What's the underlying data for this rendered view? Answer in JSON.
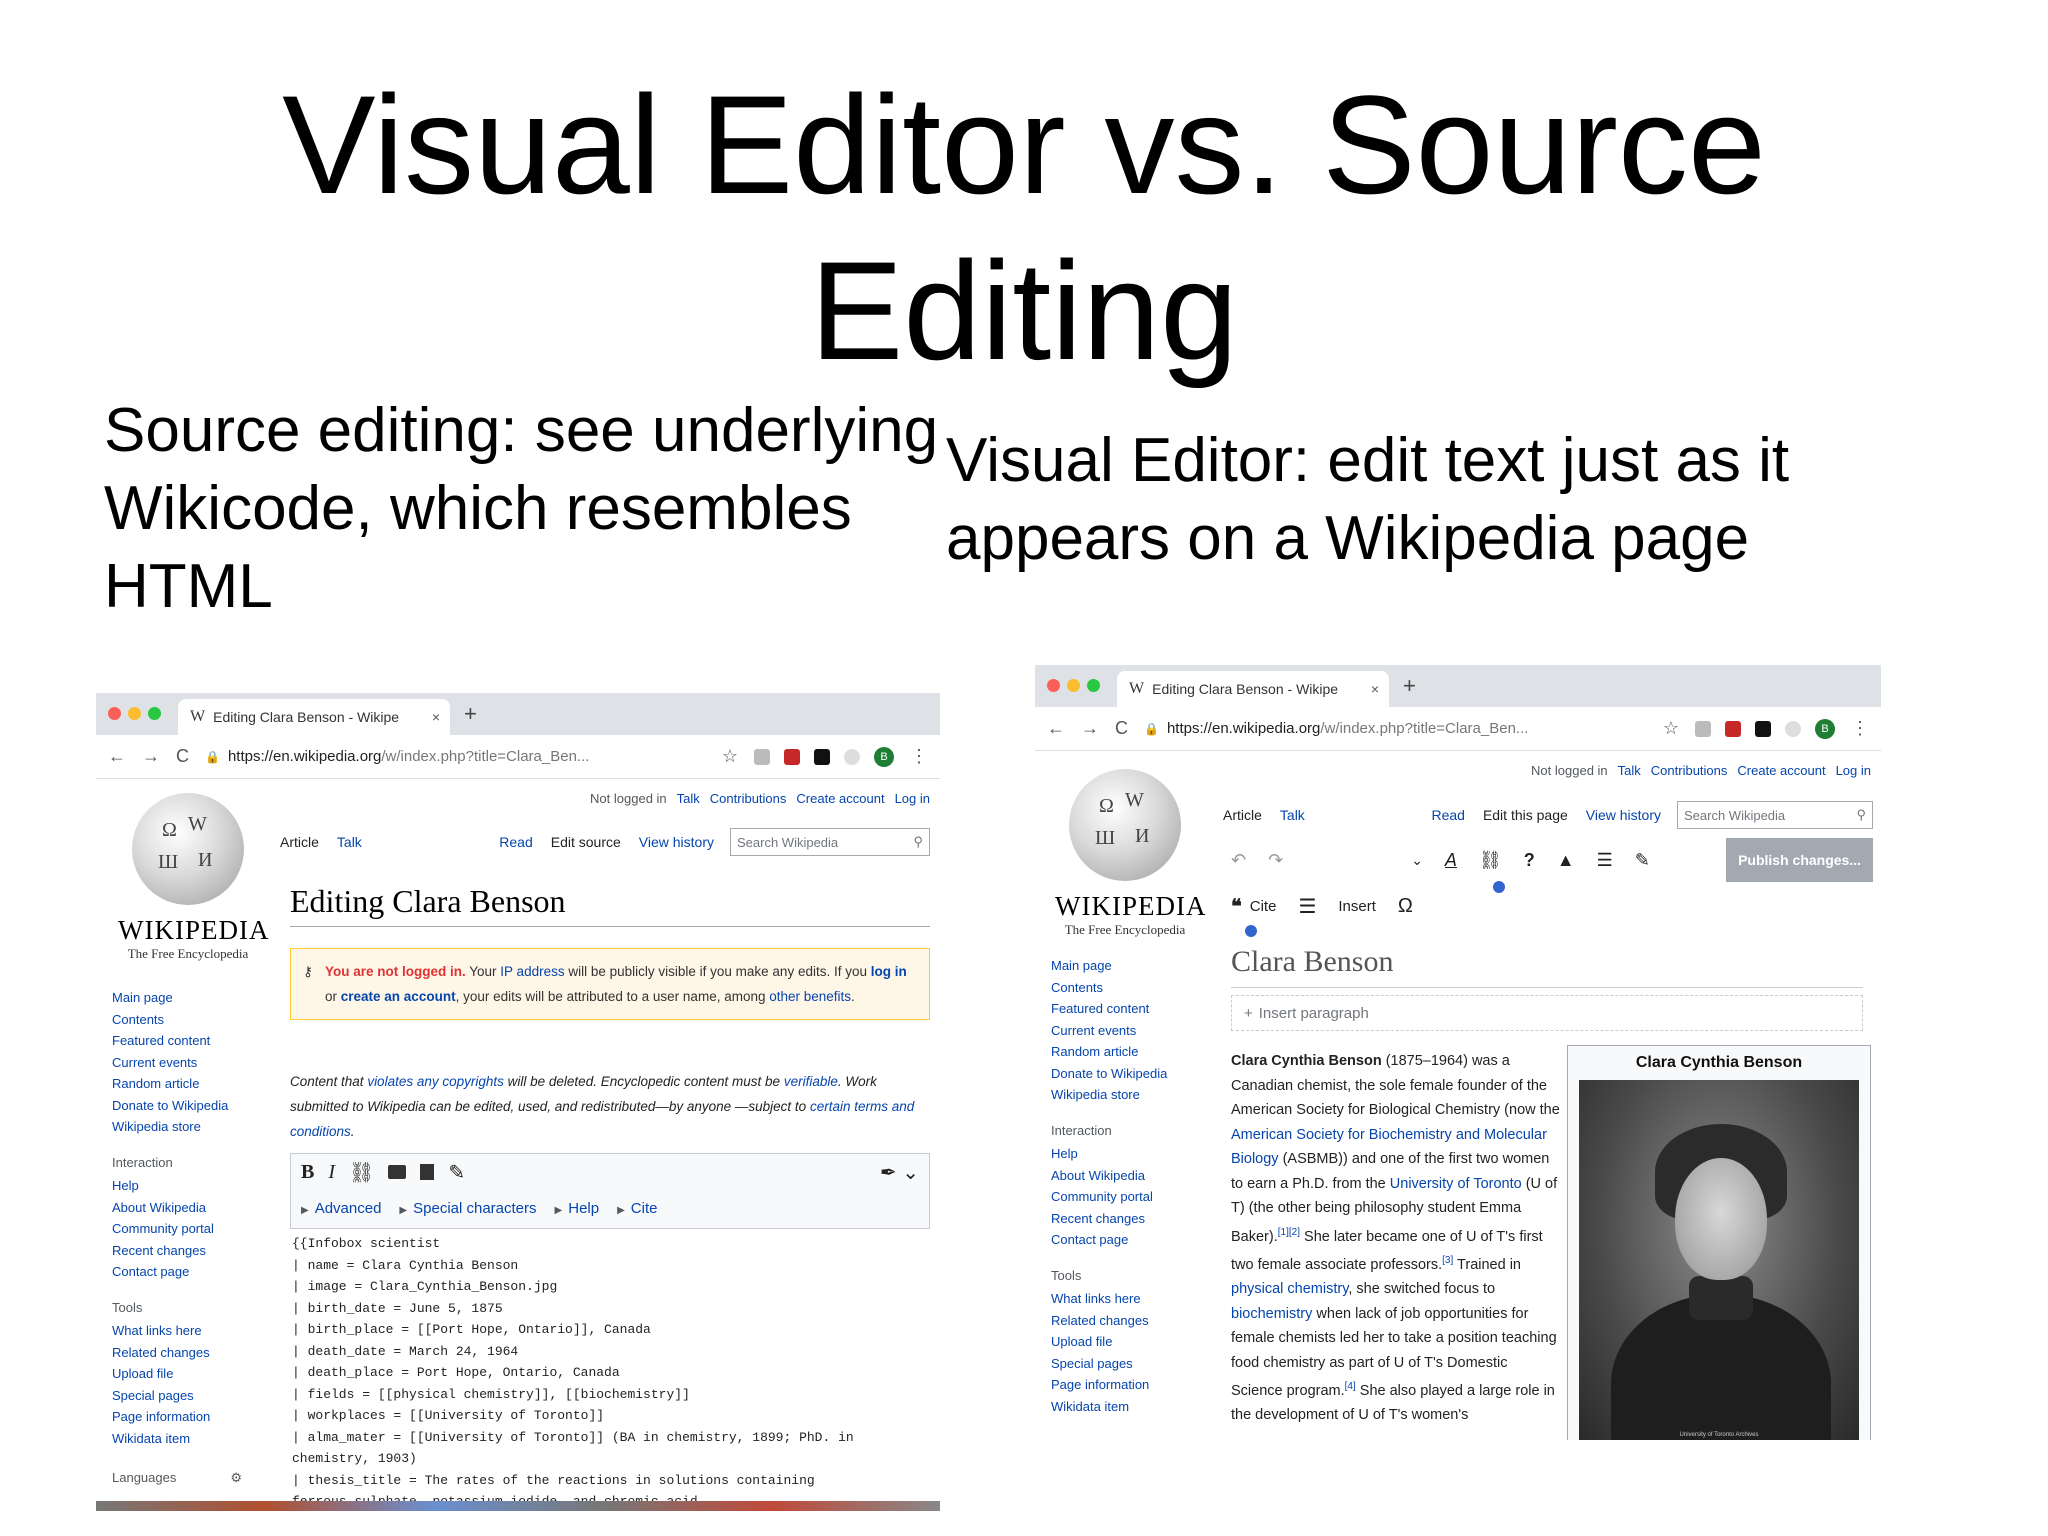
{
  "slide": {
    "title_line1": "Visual Editor vs. Source",
    "title_line2": "Editing",
    "caption_left": "Source editing: see underlying Wikicode, which resembles HTML",
    "caption_right": "Visual Editor: edit text just as it appears on a Wikipedia page"
  },
  "browser": {
    "tab_logo": "W",
    "tab_title": "Editing Clara Benson - Wikipe",
    "tab_close": "×",
    "new_tab": "+",
    "url_host": "https://en.wikipedia.org",
    "url_path": "/w/index.php?title=Clara_Ben...",
    "nav_back": "←",
    "nav_forward": "→",
    "nav_reload": "C",
    "lock": "🔒",
    "star": "☆",
    "menu": "⋮",
    "avatar": "B",
    "colors": {
      "red": "#fc5f57",
      "yellow": "#fdbc2e",
      "green": "#28c840"
    }
  },
  "personal": {
    "not_logged": "Not logged in",
    "talk": "Talk",
    "contributions": "Contributions",
    "create_account": "Create account",
    "login": "Log in"
  },
  "logo": {
    "wordmark": "WIKIPEDIA",
    "tagline": "The Free Encyclopedia"
  },
  "sidebar": {
    "main": [
      "Main page",
      "Contents",
      "Featured content",
      "Current events",
      "Random article",
      "Donate to Wikipedia",
      "Wikipedia store"
    ],
    "interaction_heading": "Interaction",
    "interaction": [
      "Help",
      "About Wikipedia",
      "Community portal",
      "Recent changes",
      "Contact page"
    ],
    "tools_heading": "Tools",
    "tools": [
      "What links here",
      "Related changes",
      "Upload file",
      "Special pages",
      "Page information",
      "Wikidata item"
    ],
    "languages_heading": "Languages"
  },
  "left_editor": {
    "tab_article": "Article",
    "tab_talk": "Talk",
    "read": "Read",
    "edit_source": "Edit source",
    "view_history": "View history",
    "search_placeholder": "Search Wikipedia",
    "heading": "Editing Clara Benson",
    "notice_red": "You are not logged in.",
    "notice_1": " Your ",
    "notice_ip": "IP address",
    "notice_2": " will be publicly visible if you make any edits. If you ",
    "notice_login": "log in",
    "notice_3": " or ",
    "notice_create": "create an account",
    "notice_4": ", your edits will be attributed to a user name, among ",
    "notice_other": "other benefits",
    "notice_5": ".",
    "copy_1": "Content that ",
    "copy_link1": "violates any copyrights",
    "copy_2": " will be deleted. Encyclopedic content must be ",
    "copy_link2": "verifiable",
    "copy_3": ". Work submitted to Wikipedia can be edited, used, and redistributed—by anyone —subject to ",
    "copy_link3": "certain terms and conditions",
    "copy_4": ".",
    "toolbar_bold": "B",
    "toolbar_italic": "I",
    "toolbar_link": "⛓",
    "toolbar_pen": "✎",
    "toolbar_more": "✒ ⌄",
    "row2": [
      "Advanced",
      "Special characters",
      "Help",
      "Cite"
    ],
    "code": "{{Infobox scientist\n| name = Clara Cynthia Benson\n| image = Clara_Cynthia_Benson.jpg\n| birth_date = June 5, 1875\n| birth_place = [[Port Hope, Ontario]], Canada\n| death_date = March 24, 1964\n| death_place = Port Hope, Ontario, Canada\n| fields = [[physical chemistry]], [[biochemistry]]\n| workplaces = [[University of Toronto]]\n| alma_mater = [[University of Toronto]] (BA in chemistry, 1899; PhD. in\nchemistry, 1903)\n| thesis_title = The rates of the reactions in solutions containing\nferrous sulphate, potassium iodide, and chromic acid"
  },
  "right_editor": {
    "tab_article": "Article",
    "tab_talk": "Talk",
    "read": "Read",
    "edit_this_page": "Edit this page",
    "view_history": "View history",
    "search_placeholder": "Search Wikipedia",
    "undo": "↶",
    "redo": "↷",
    "para_chevron": "⌄",
    "text_style": "A",
    "link": "⛓",
    "help": "?",
    "warning": "▲",
    "menu": "☰",
    "pencil": "✎",
    "publish": "Publish changes...",
    "cite_icon": "❝",
    "cite": "Cite",
    "list": "☰",
    "insert": "Insert",
    "omega": "Ω",
    "heading": "Clara Benson",
    "insert_paragraph": "Insert paragraph",
    "plus": "+",
    "infobox_title": "Clara Cynthia Benson",
    "photo_credit": "University of Toronto Archives"
  },
  "article": {
    "p_bold": "Clara Cynthia Benson",
    "p1": " (1875–1964) was a Canadian chemist, the sole female founder of the American Society for Biological Chemistry (now the ",
    "link_asbmb": "American Society for Biochemistry and Molecular Biology",
    "p2": " (ASBMB)) and one of the first two women to earn a Ph.D. from the ",
    "link_uoft": "University of Toronto",
    "p3": " (U of T) (the other being philosophy student Emma Baker).",
    "ref12": "[1][2]",
    "p4": " She later became one of U of T's first two female associate professors.",
    "ref3": "[3]",
    "p5": " Trained in ",
    "link_physchem": "physical chemistry",
    "p6": ", she switched focus to ",
    "link_biochem": "biochemistry",
    "p7": " when lack of job opportunities for female chemists led her to take a position teaching food chemistry as part of U of T's Domestic Science program.",
    "ref4": "[4]",
    "p8": " She also played a large role in the development of U of T's women's"
  }
}
